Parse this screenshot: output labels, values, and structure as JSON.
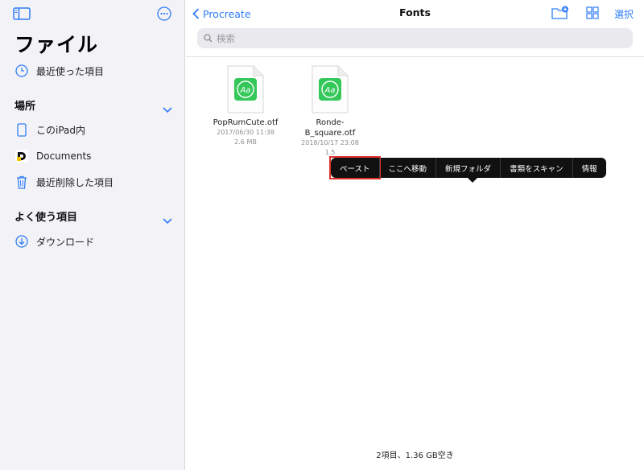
{
  "sidebar": {
    "title": "ファイル",
    "recents": {
      "label": "最近使った項目",
      "icon": "clock-icon"
    },
    "locations_header": "場所",
    "locations": [
      {
        "label": "このiPad内",
        "icon": "ipad-icon"
      },
      {
        "label": "Documents",
        "icon": "documents-app-icon"
      },
      {
        "label": "最近削除した項目",
        "icon": "trash-icon"
      }
    ],
    "favorites_header": "よく使う項目",
    "favorites": [
      {
        "label": "ダウンロード",
        "icon": "download-icon"
      }
    ]
  },
  "nav": {
    "back_label": "Procreate",
    "title": "Fonts",
    "select_label": "選択"
  },
  "search": {
    "placeholder": "検索"
  },
  "files": [
    {
      "name": "PopRumCute.otf",
      "date": "2017/06/30 11:38",
      "size": "2.6 MB"
    },
    {
      "name": "Ronde-\nB_square.otf",
      "date": "2018/10/17 23:08",
      "size": "1.5"
    }
  ],
  "context_menu": {
    "items": [
      "ペースト",
      "ここへ移動",
      "新規フォルダ",
      "書類をスキャン",
      "情報"
    ],
    "highlighted": "ペースト"
  },
  "status": "2項目、1.36 GB空き",
  "colors": {
    "accent": "#2f7df6",
    "font_icon": "#34c759",
    "highlight": "#e0312a"
  }
}
